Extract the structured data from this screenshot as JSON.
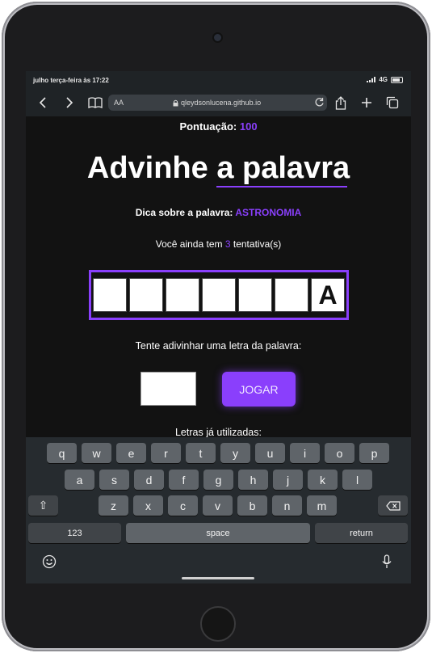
{
  "status": {
    "time": "julho terça-feira às 17:22",
    "network": "4G"
  },
  "browser": {
    "aa_label": "AA",
    "url": "qleydsonlucena.github.io"
  },
  "game": {
    "score_label": "Pontuação:",
    "score_value": "100",
    "title": "Advinhe a palavra",
    "hint_label": "Dica sobre a palavra:",
    "hint_value": "ASTRONOMIA",
    "tries_prefix": "Você ainda tem",
    "tries_value": "3",
    "tries_suffix": "tentativa(s)",
    "letters": [
      "",
      "",
      "",
      "",
      "",
      "",
      "A"
    ],
    "prompt": "Tente adivinhar uma letra da palavra:",
    "guess_value": "",
    "play_label": "JOGAR",
    "used_label": "Letras já utilizadas:"
  },
  "keyboard": {
    "row1": [
      "q",
      "w",
      "e",
      "r",
      "t",
      "y",
      "u",
      "i",
      "o",
      "p"
    ],
    "row2": [
      "a",
      "s",
      "d",
      "f",
      "g",
      "h",
      "j",
      "k",
      "l"
    ],
    "row3": [
      "z",
      "x",
      "c",
      "v",
      "b",
      "n",
      "m"
    ],
    "shift_glyph": "⇧",
    "numbers_label": "123",
    "space_label": "space",
    "return_label": "return"
  },
  "colors": {
    "accent": "#8a3ffc",
    "background": "#121212"
  }
}
